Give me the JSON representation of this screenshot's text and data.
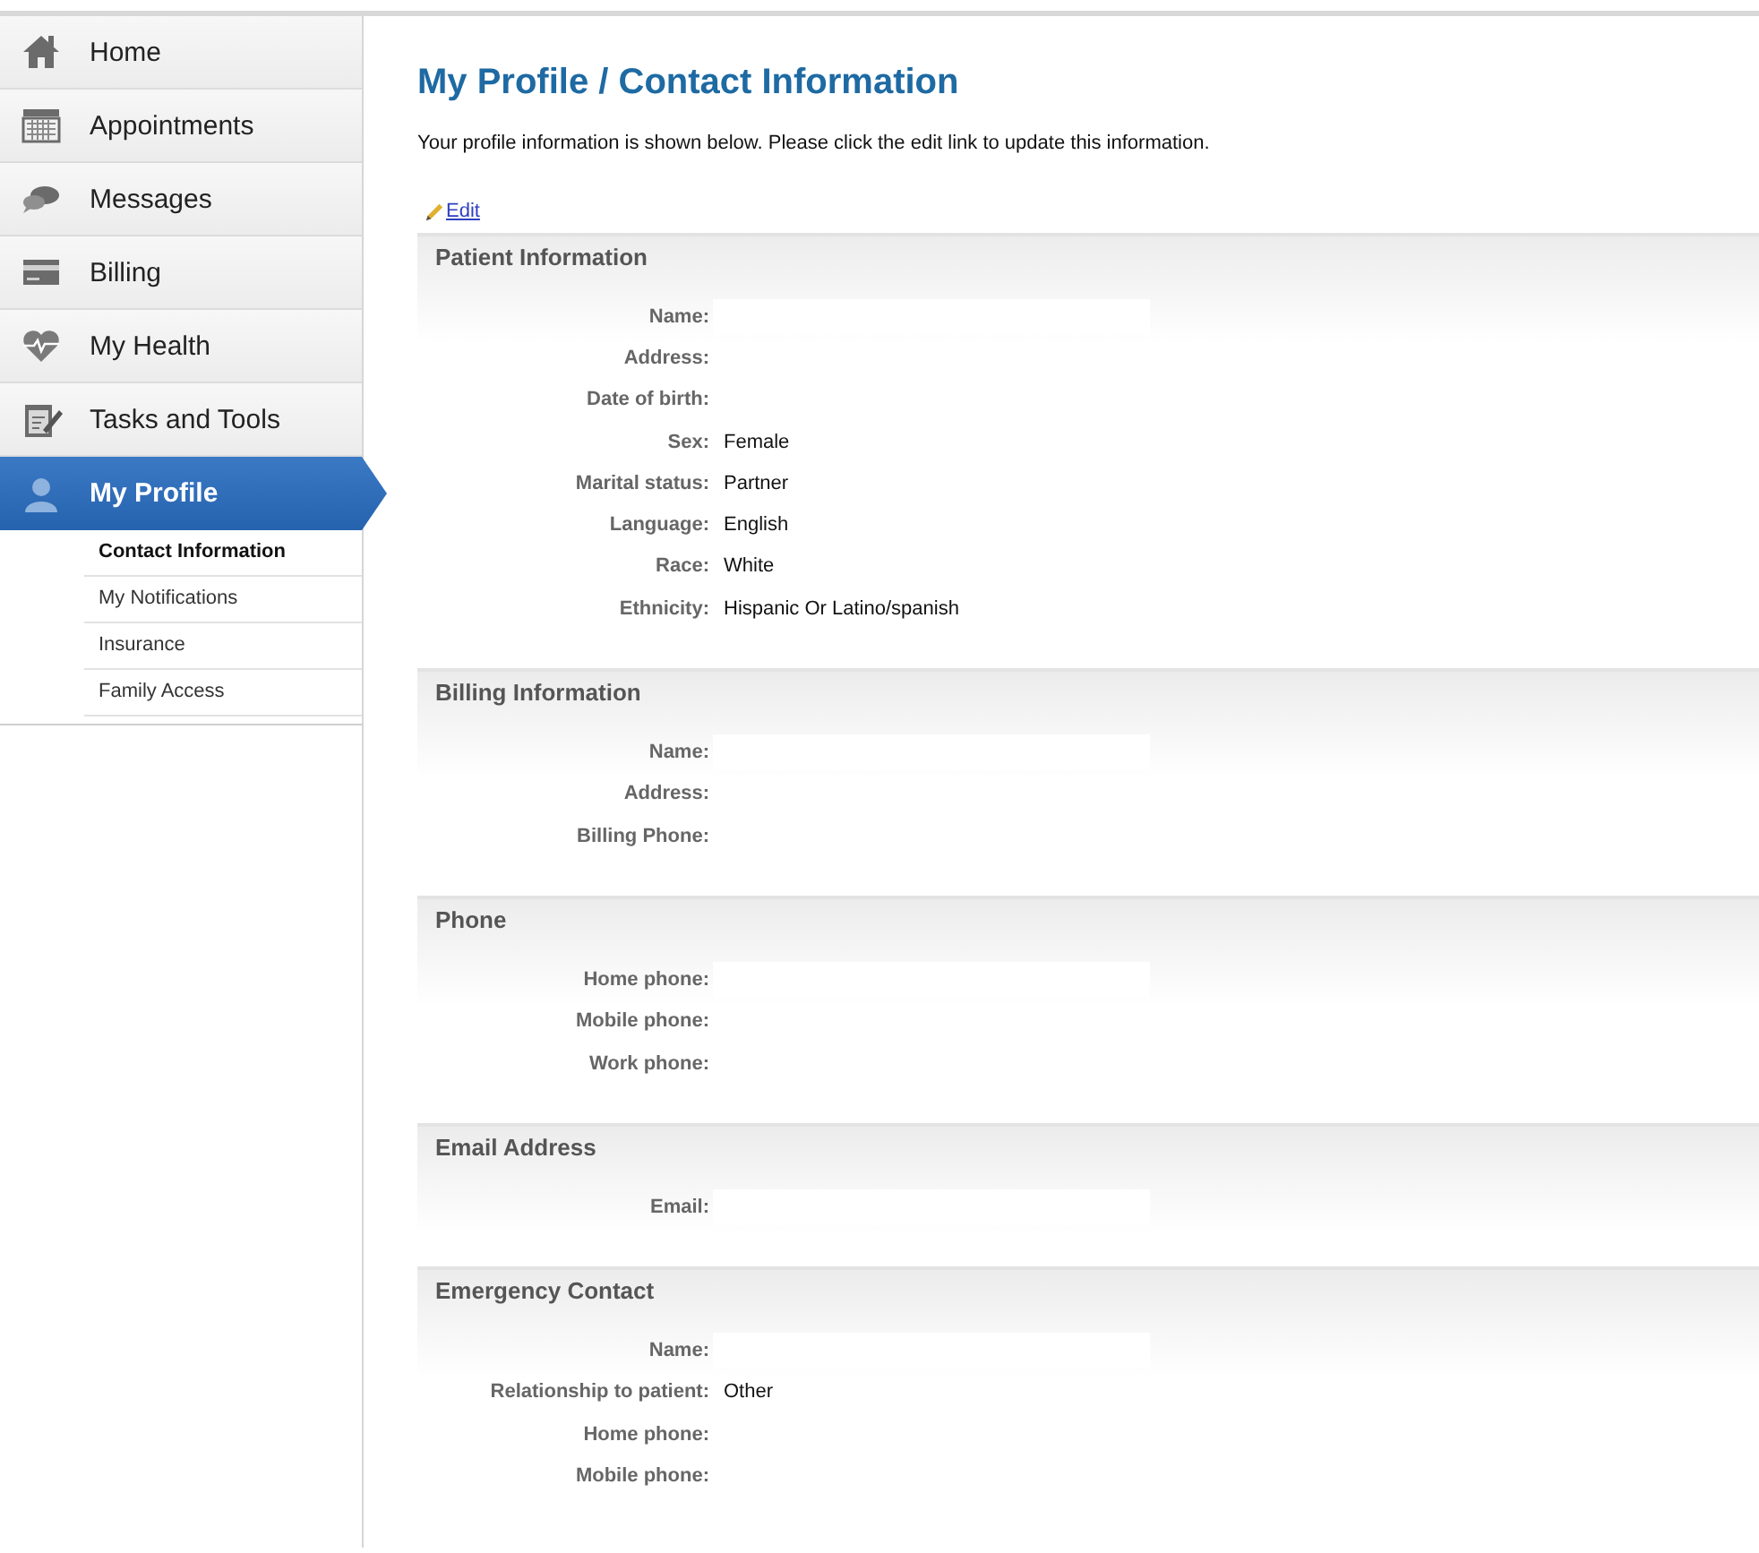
{
  "sidebar": {
    "items": [
      {
        "label": "Home",
        "selected": false
      },
      {
        "label": "Appointments",
        "selected": false
      },
      {
        "label": "Messages",
        "selected": false
      },
      {
        "label": "Billing",
        "selected": false
      },
      {
        "label": "My Health",
        "selected": false
      },
      {
        "label": "Tasks and Tools",
        "selected": false
      },
      {
        "label": "My Profile",
        "selected": true,
        "children": [
          {
            "label": "Contact Information",
            "selected": true
          },
          {
            "label": "My Notifications",
            "selected": false
          },
          {
            "label": "Insurance",
            "selected": false
          },
          {
            "label": "Family Access",
            "selected": false
          }
        ]
      }
    ]
  },
  "page": {
    "title": "My Profile / Contact Information",
    "intro": "Your profile information is shown below. Please click the edit link to update this information.",
    "edit_link": "Edit"
  },
  "sections": [
    {
      "title": "Patient Information",
      "fields": [
        {
          "label": "Name:",
          "redacted": true
        },
        {
          "label": "Address:",
          "redacted": false
        },
        {
          "label": "Date of birth:",
          "redacted": false
        },
        {
          "label": "Sex:",
          "value": "Female",
          "redacted": false
        },
        {
          "label": "Marital status:",
          "value": "Partner",
          "redacted": false
        },
        {
          "label": "Language:",
          "value": "English",
          "redacted": false
        },
        {
          "label": "Race:",
          "value": "White",
          "redacted": false
        },
        {
          "label": "Ethnicity:",
          "value": "Hispanic Or Latino/spanish",
          "redacted": false
        }
      ]
    },
    {
      "title": "Billing Information",
      "fields": [
        {
          "label": "Name:",
          "redacted": true
        },
        {
          "label": "Address:",
          "redacted": false
        },
        {
          "label": "Billing Phone:",
          "redacted": false
        }
      ]
    },
    {
      "title": "Phone",
      "fields": [
        {
          "label": "Home phone:",
          "redacted": true
        },
        {
          "label": "Mobile phone:",
          "redacted": false
        },
        {
          "label": "Work phone:",
          "redacted": false
        }
      ]
    },
    {
      "title": "Email Address",
      "fields": [
        {
          "label": "Email:",
          "redacted": true
        }
      ]
    },
    {
      "title": "Emergency Contact",
      "fields": [
        {
          "label": "Name:",
          "redacted": true
        },
        {
          "label": "Relationship to patient:",
          "value": "Other",
          "redacted": false
        },
        {
          "label": "Home phone:",
          "redacted": false
        },
        {
          "label": "Mobile phone:",
          "redacted": false
        }
      ]
    }
  ]
}
